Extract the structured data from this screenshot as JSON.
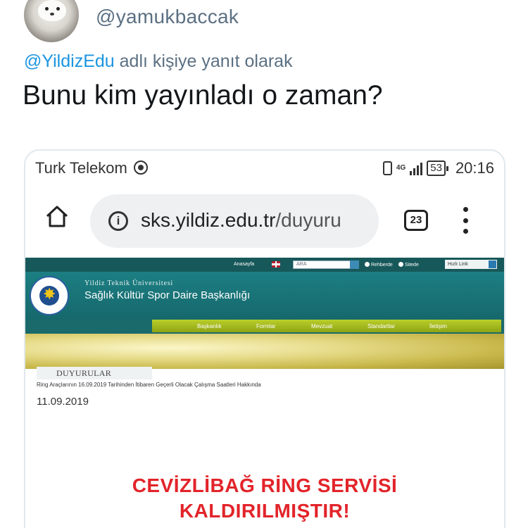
{
  "tweet": {
    "handle": "@yamukbaccak",
    "reply_prefix_mention": "@YildizEdu",
    "reply_suffix": "adlı kişiye yanıt olarak",
    "text": "Bunu kim yayınladı o zaman?"
  },
  "phone": {
    "carrier": "Turk Telekom",
    "network": "4G",
    "battery": "53",
    "time": "20:16"
  },
  "browser": {
    "url_host": "sks.yildiz.edu.tr",
    "url_path": "/duyuru",
    "tab_count": "23"
  },
  "site": {
    "top_home": "Anasayfa",
    "search_placeholder": "ARA",
    "radio_1": "Rehberde",
    "radio_2": "Sitede",
    "quick_link": "Hızlı Link",
    "university": "Yildiz Teknik Üniversitesi",
    "department": "Sağlık Kültür Spor Daire Başkanlığı",
    "nav": [
      "Başkanlık",
      "Formlar",
      "Mevzuat",
      "Standartlar",
      "İletişim"
    ],
    "section_title": "DUYURULAR",
    "announcement_title": "Ring Araçlarının 16.09.2019 Tarihinden İtibaren Geçerli Olacak Çalışma Saatleri Hakkında",
    "announcement_date": "11.09.2019",
    "headline_line1": "CEVİZLİBAĞ RİNG SERVİSİ",
    "headline_line2": "KALDIRILMIŞTIR!"
  },
  "colors": {
    "mention": "#1b95e0",
    "site_teal": "#17585a",
    "nav_green": "#9fb51c",
    "headline_red": "#e2242a"
  }
}
